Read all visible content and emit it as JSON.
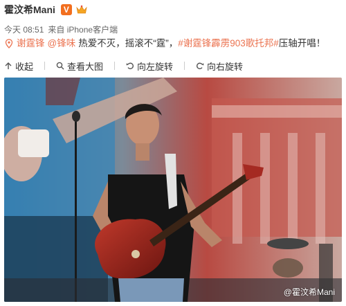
{
  "post": {
    "username": "霍汶希Mani",
    "verified_badge": "V",
    "time": "今天 08:51",
    "source": "来自 iPhone客户端",
    "content": {
      "mention1": "谢霆锋",
      "mention2": "@锋味",
      "text1": "热爱不灭，摇滚不“霆”，",
      "hashtag": "#谢霆锋霹雳903歌托邦#",
      "text2": "压轴开唱！"
    },
    "toolbar": {
      "collapse": "收起",
      "view_large": "查看大图",
      "rotate_left": "向左旋转",
      "rotate_right": "向右旋转"
    },
    "watermark": "@霍汶希Mani"
  },
  "colors": {
    "link": "#eb7350",
    "verified": "#f26f1f",
    "guitar": "#8b1f1d",
    "background": "#ffffff"
  }
}
